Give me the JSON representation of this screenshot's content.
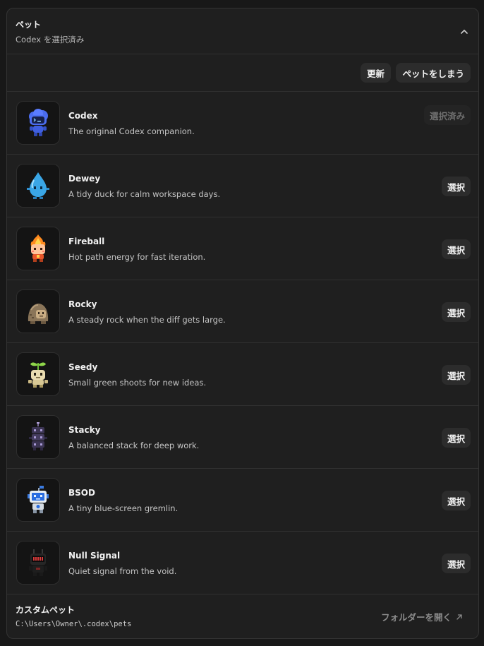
{
  "header": {
    "title": "ペット",
    "subtitle": "Codex を選択済み"
  },
  "toolbar": {
    "refresh_label": "更新",
    "put_away_label": "ペットをしまう"
  },
  "pets": [
    {
      "name": "Codex",
      "description": "The original Codex companion.",
      "button": "選択済み",
      "selected": true,
      "icon": "codex-cloud-robot-icon"
    },
    {
      "name": "Dewey",
      "description": "A tidy duck for calm workspace days.",
      "button": "選択",
      "selected": false,
      "icon": "water-drop-icon"
    },
    {
      "name": "Fireball",
      "description": "Hot path energy for fast iteration.",
      "button": "選択",
      "selected": false,
      "icon": "fireball-icon"
    },
    {
      "name": "Rocky",
      "description": "A steady rock when the diff gets large.",
      "button": "選択",
      "selected": false,
      "icon": "rock-icon"
    },
    {
      "name": "Seedy",
      "description": "Small green shoots for new ideas.",
      "button": "選択",
      "selected": false,
      "icon": "seedling-icon"
    },
    {
      "name": "Stacky",
      "description": "A balanced stack for deep work.",
      "button": "選択",
      "selected": false,
      "icon": "stack-icon"
    },
    {
      "name": "BSOD",
      "description": "A tiny blue-screen gremlin.",
      "button": "選択",
      "selected": false,
      "icon": "blue-screen-robot-icon"
    },
    {
      "name": "Null Signal",
      "description": "Quiet signal from the void.",
      "button": "選択",
      "selected": false,
      "icon": "null-signal-robot-icon"
    }
  ],
  "footer": {
    "title": "カスタムペット",
    "path": "C:\\Users\\Owner\\.codex\\pets",
    "open_folder_label": "フォルダーを開く"
  }
}
